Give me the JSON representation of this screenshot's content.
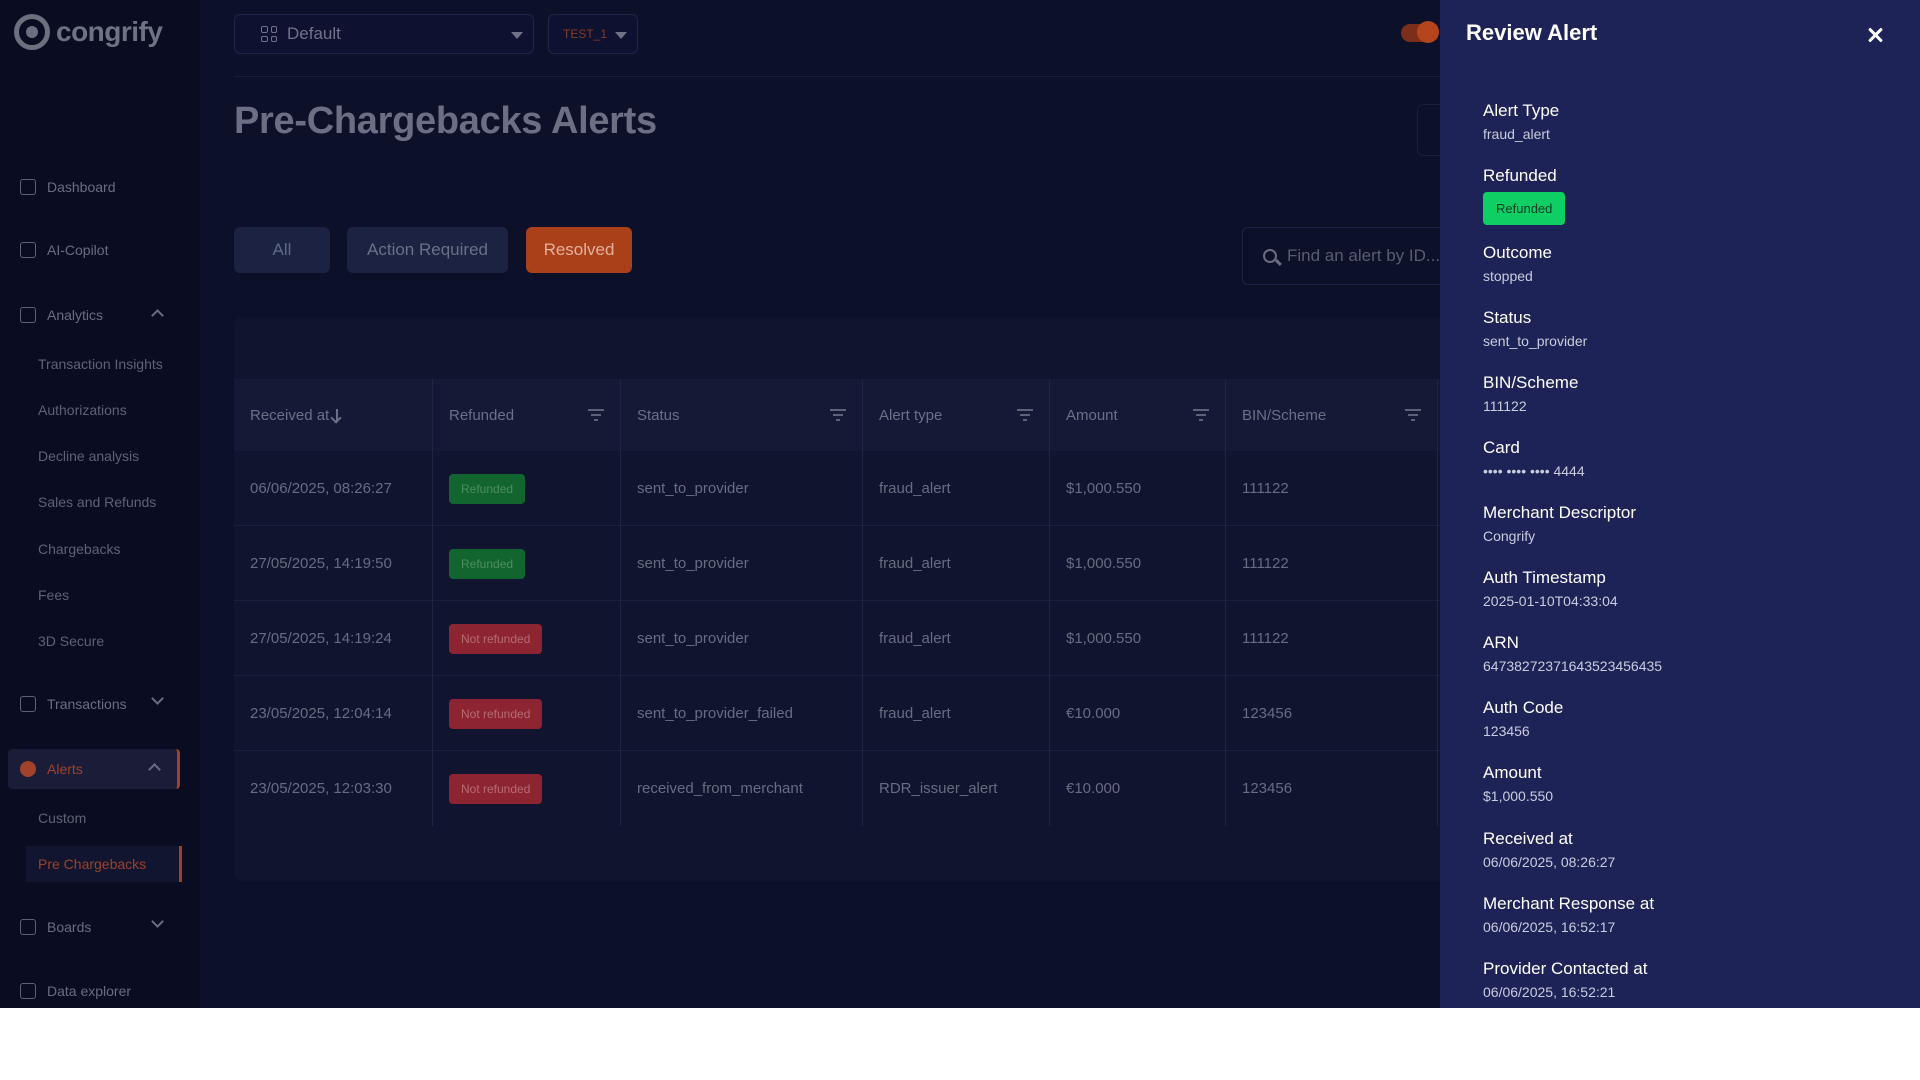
{
  "app": {
    "name": "congrify"
  },
  "header": {
    "dashboard_select": "Default",
    "env_select": "TEST_1",
    "page_title": "Pre-Chargebacks Alerts"
  },
  "sidebar": {
    "items": [
      {
        "label": "Dashboard",
        "icon": "home-icon"
      },
      {
        "label": "AI-Copilot",
        "icon": "chat-icon"
      },
      {
        "label": "Analytics",
        "icon": "chart-icon"
      },
      {
        "label": "Transactions",
        "icon": "chart-icon"
      },
      {
        "label": "Alerts",
        "icon": "alert-icon"
      },
      {
        "label": "Boards",
        "icon": "chart-icon"
      },
      {
        "label": "Data explorer",
        "icon": "chart-icon"
      }
    ],
    "analytics_sub": [
      "Transaction Insights",
      "Authorizations",
      "Decline analysis",
      "Sales and Refunds",
      "Chargebacks",
      "Fees",
      "3D Secure"
    ],
    "alerts_sub": [
      "Custom",
      "Pre Chargebacks"
    ]
  },
  "tabs": {
    "all": "All",
    "action": "Action Required",
    "resolved": "Resolved"
  },
  "search": {
    "placeholder": "Find an alert by ID..."
  },
  "table": {
    "headers": [
      "Received at",
      "Refunded",
      "Status",
      "Alert type",
      "Amount",
      "BIN/Scheme"
    ],
    "rows": [
      {
        "received": "06/06/2025, 08:26:27",
        "refunded": "Refunded",
        "status": "sent_to_provider",
        "type": "fraud_alert",
        "amount": "$1,000.550",
        "bin": "111122"
      },
      {
        "received": "27/05/2025, 14:19:50",
        "refunded": "Refunded",
        "status": "sent_to_provider",
        "type": "fraud_alert",
        "amount": "$1,000.550",
        "bin": "111122"
      },
      {
        "received": "27/05/2025, 14:19:24",
        "refunded": "Not refunded",
        "status": "sent_to_provider",
        "type": "fraud_alert",
        "amount": "$1,000.550",
        "bin": "111122"
      },
      {
        "received": "23/05/2025, 12:04:14",
        "refunded": "Not refunded",
        "status": "sent_to_provider_failed",
        "type": "fraud_alert",
        "amount": "€10.000",
        "bin": "123456"
      },
      {
        "received": "23/05/2025, 12:03:30",
        "refunded": "Not refunded",
        "status": "received_from_merchant",
        "type": "RDR_issuer_alert",
        "amount": "€10.000",
        "bin": "123456"
      }
    ]
  },
  "panel": {
    "title": "Review Alert",
    "fields": [
      {
        "label": "Alert Type",
        "value": "fraud_alert"
      },
      {
        "label": "Refunded",
        "badge": "Refunded"
      },
      {
        "label": "Outcome",
        "value": "stopped"
      },
      {
        "label": "Status",
        "value": "sent_to_provider"
      },
      {
        "label": "BIN/Scheme",
        "value": "111122"
      },
      {
        "label": "Card",
        "value": "•••• •••• •••• 4444"
      },
      {
        "label": "Merchant Descriptor",
        "value": "Congrify"
      },
      {
        "label": "Auth Timestamp",
        "value": "2025-01-10T04:33:04"
      },
      {
        "label": "ARN",
        "value": "64738272371643523456435"
      },
      {
        "label": "Auth Code",
        "value": "123456"
      },
      {
        "label": "Amount",
        "value": "$1,000.550"
      },
      {
        "label": "Received at",
        "value": "06/06/2025, 08:26:27"
      },
      {
        "label": "Merchant Response at",
        "value": "06/06/2025, 16:52:17"
      },
      {
        "label": "Provider Contacted at",
        "value": "06/06/2025, 16:52:21"
      }
    ]
  },
  "colors": {
    "accent": "#a9401a",
    "panel_bg": "#1e2357",
    "success": "#0fce63",
    "danger": "#8c2432"
  }
}
